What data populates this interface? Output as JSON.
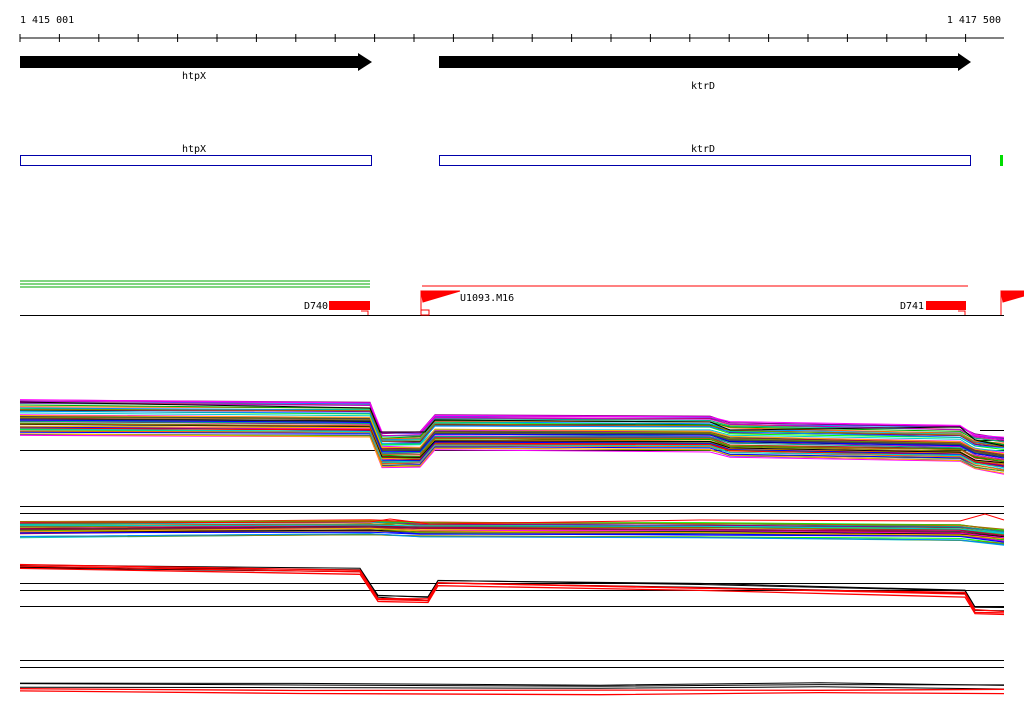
{
  "ruler": {
    "start_label": "1 415 001",
    "end_label": "1 417 500"
  },
  "genes": [
    {
      "name": "htpX",
      "strand": "+"
    },
    {
      "name": "ktrD",
      "strand": "+"
    }
  ],
  "cds_track": [
    {
      "label": "htpX",
      "color": "#0000aa"
    },
    {
      "label": "ktrD",
      "color": "#0000aa"
    }
  ],
  "feature_marker": {
    "color": "#00dd00"
  },
  "annotations": {
    "left_element": "D740",
    "middle_element": "U1093.M16",
    "right_element": "D741"
  },
  "colors": {
    "gene_arrow": "#000000",
    "feature_red": "#ff0000",
    "cds_outline": "#0000aa",
    "track_green": "#00aa00"
  },
  "palette": [
    "#ff0000",
    "#00aa00",
    "#0000ff",
    "#ff00ff",
    "#00cccc",
    "#ffaa00",
    "#880088",
    "#888800",
    "#000000",
    "#ff6600",
    "#00ff00",
    "#0088ff",
    "#aa0044",
    "#66aa00",
    "#cc00cc",
    "#444444",
    "#00aa88",
    "#aa6600"
  ]
}
